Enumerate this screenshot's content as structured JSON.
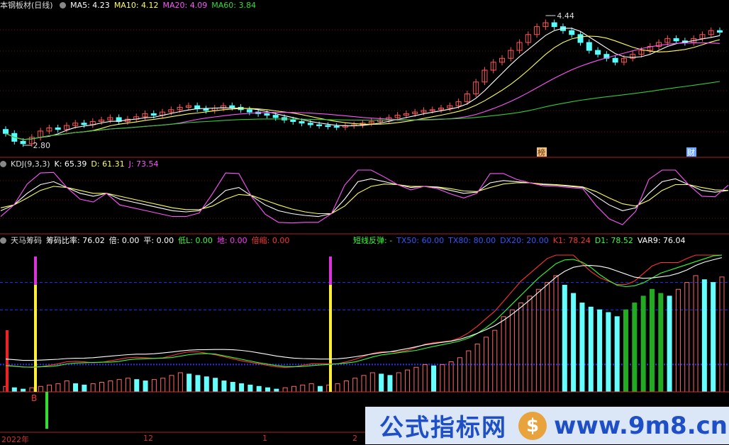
{
  "main_panel": {
    "title": "本钢板材(日线)",
    "indicators": [
      {
        "label": "MA5: 4.23",
        "color": "#ffffff"
      },
      {
        "label": "MA10: 4.12",
        "color": "#ffff55"
      },
      {
        "label": "MA20: 4.09",
        "color": "#ff55ff"
      },
      {
        "label": "MA60: 3.84",
        "color": "#33dd33"
      }
    ],
    "high_label": "4.44",
    "low_label": "2.80",
    "marks": [
      "榜",
      "财"
    ]
  },
  "kdj_panel": {
    "title": "KDJ(9,3,3)",
    "values": [
      {
        "label": "K: 65.39",
        "color": "#ffffff"
      },
      {
        "label": "D: 61.31",
        "color": "#ffff55"
      },
      {
        "label": "J: 73.54",
        "color": "#ff55ff"
      }
    ]
  },
  "chip_panel": {
    "title": "天马筹码",
    "values": [
      {
        "label": "筹码比率: 76.02",
        "color": "#ffffff"
      },
      {
        "label": "倍: 0.00",
        "color": "#ffffff"
      },
      {
        "label": "平: 0.00",
        "color": "#ffffff"
      },
      {
        "label": "低L: 0.00",
        "color": "#33ff33"
      },
      {
        "label": "地: 0.00",
        "color": "#ff33ff"
      },
      {
        "label": "倍缩: 0.00",
        "color": "#ff3333"
      }
    ],
    "values_right": [
      {
        "label": "短线反弹: -",
        "color": "#33ff33"
      },
      {
        "label": "TX50: 60.00",
        "color": "#3355ff"
      },
      {
        "label": "TX80: 80.00",
        "color": "#3355ff"
      },
      {
        "label": "DX20: 20.00",
        "color": "#3355ff"
      },
      {
        "label": "K1: 78.24",
        "color": "#ff3333"
      },
      {
        "label": "D1: 78.52",
        "color": "#33ff33"
      },
      {
        "label": "VAR9: 76.04",
        "color": "#ffffff"
      }
    ],
    "b_label": "B"
  },
  "x_axis": [
    "2022年",
    "12",
    "1",
    "2"
  ],
  "watermark": {
    "text1": "公式指标网",
    "logo": "$",
    "text2": "www.9m8.cn"
  },
  "colors": {
    "up": "#ff5555",
    "down": "#55ffff",
    "ma60": "#33cc33",
    "ma20": "#cc33cc"
  },
  "chart_data": [
    {
      "type": "candlestick",
      "title": "本钢板材(日线)",
      "annotations": {
        "max": 4.44,
        "min": 2.8
      },
      "ma": {
        "MA5": 4.23,
        "MA10": 4.12,
        "MA20": 4.09,
        "MA60": 3.84
      },
      "close_series": [
        2.95,
        2.85,
        2.82,
        2.9,
        2.98,
        3.02,
        3.0,
        3.05,
        3.08,
        3.06,
        3.1,
        3.12,
        3.15,
        3.1,
        3.13,
        3.16,
        3.2,
        3.18,
        3.22,
        3.25,
        3.28,
        3.3,
        3.26,
        3.24,
        3.27,
        3.3,
        3.28,
        3.25,
        3.22,
        3.2,
        3.18,
        3.15,
        3.12,
        3.1,
        3.08,
        3.06,
        3.05,
        3.04,
        3.03,
        3.05,
        3.06,
        3.08,
        3.1,
        3.12,
        3.15,
        3.18,
        3.2,
        3.22,
        3.24,
        3.25,
        3.27,
        3.3,
        3.35,
        3.45,
        3.6,
        3.75,
        3.85,
        3.9,
        4.0,
        4.1,
        4.2,
        4.3,
        4.35,
        4.3,
        4.25,
        4.2,
        4.1,
        4.0,
        3.95,
        3.9,
        3.85,
        3.9,
        3.95,
        4.0,
        4.05,
        4.1,
        4.15,
        4.12,
        4.1,
        4.15,
        4.2,
        4.25,
        4.23
      ]
    },
    {
      "type": "line",
      "title": "KDJ(9,3,3)",
      "series": [
        {
          "name": "K",
          "values": [
            30,
            40,
            60,
            75,
            80,
            70,
            60,
            55,
            60,
            50,
            45,
            40,
            35,
            30,
            28,
            30,
            45,
            65,
            70,
            55,
            40,
            30,
            25,
            22,
            20,
            25,
            50,
            80,
            85,
            80,
            75,
            70,
            72,
            70,
            65,
            60,
            62,
            78,
            82,
            80,
            78,
            75,
            74,
            72,
            70,
            55,
            40,
            30,
            35,
            60,
            80,
            85,
            75,
            65,
            62,
            65
          ]
        },
        {
          "name": "D",
          "values": [
            35,
            40,
            52,
            65,
            72,
            70,
            65,
            60,
            60,
            55,
            50,
            45,
            40,
            35,
            32,
            32,
            38,
            50,
            58,
            56,
            48,
            40,
            33,
            28,
            25,
            25,
            38,
            60,
            72,
            76,
            75,
            72,
            72,
            71,
            68,
            64,
            63,
            70,
            76,
            78,
            78,
            76,
            75,
            73,
            71,
            63,
            52,
            42,
            38,
            48,
            65,
            75,
            75,
            70,
            66,
            65
          ]
        },
        {
          "name": "J",
          "values": [
            20,
            40,
            76,
            95,
            96,
            70,
            50,
            45,
            60,
            40,
            35,
            30,
            25,
            20,
            20,
            26,
            59,
            95,
            94,
            53,
            24,
            10,
            9,
            10,
            10,
            25,
            74,
            100,
            100,
            88,
            75,
            66,
            72,
            68,
            59,
            52,
            60,
            94,
            94,
            84,
            78,
            73,
            72,
            70,
            68,
            39,
            16,
            6,
            29,
            84,
            100,
            100,
            75,
            55,
            54,
            74
          ]
        }
      ],
      "values": {
        "K": 65.39,
        "D": 61.31,
        "J": 73.54
      },
      "ylim": [
        0,
        100
      ]
    },
    {
      "type": "bar",
      "title": "天马筹码",
      "reference_lines": {
        "TX80": 80,
        "TX50": 60,
        "DX20": 20
      },
      "values": {
        "筹码比率": 76.02,
        "K1": 78.24,
        "D1": 78.52,
        "VAR9": 76.04
      },
      "bars": [
        4,
        3,
        2,
        3,
        4,
        5,
        6,
        8,
        6,
        5,
        6,
        7,
        8,
        9,
        10,
        9,
        8,
        9,
        10,
        12,
        14,
        13,
        12,
        11,
        10,
        8,
        7,
        6,
        5,
        4,
        3,
        2,
        3,
        4,
        5,
        6,
        4,
        5,
        6,
        8,
        10,
        12,
        14,
        13,
        12,
        14,
        16,
        18,
        20,
        19,
        20,
        22,
        25,
        30,
        35,
        40,
        45,
        55,
        60,
        65,
        70,
        75,
        80,
        85,
        78,
        72,
        65,
        62,
        60,
        58,
        55,
        60,
        65,
        70,
        75,
        72,
        70,
        75,
        80,
        85,
        82,
        80,
        84
      ]
    }
  ]
}
